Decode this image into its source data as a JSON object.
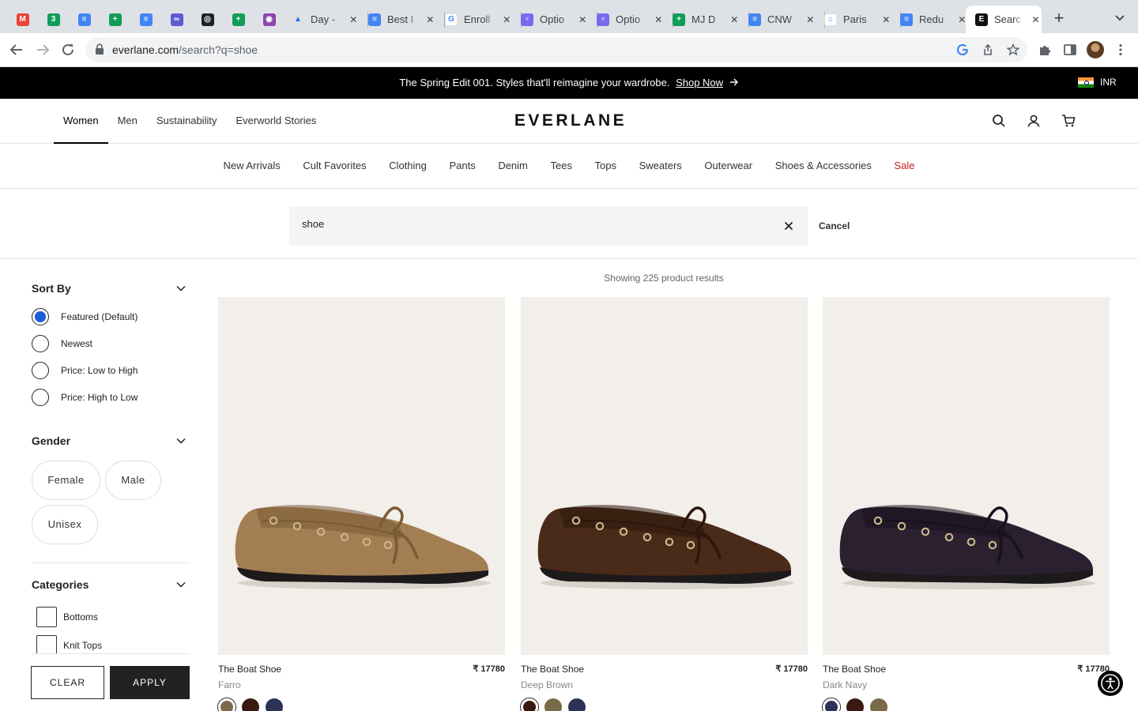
{
  "browser": {
    "tabs": [
      {
        "title": "",
        "color": "#ea4335",
        "glyph": "M",
        "pinned": true
      },
      {
        "title": "",
        "color": "#0f9d58",
        "glyph": "3",
        "pinned": true
      },
      {
        "title": "",
        "color": "#4285f4",
        "glyph": "≡",
        "pinned": true
      },
      {
        "title": "",
        "color": "#0f9d58",
        "glyph": "+",
        "pinned": true
      },
      {
        "title": "",
        "color": "#4285f4",
        "glyph": "≡",
        "pinned": true
      },
      {
        "title": "",
        "color": "#5b5bd6",
        "glyph": "∞",
        "pinned": true
      },
      {
        "title": "",
        "color": "#202124",
        "glyph": "◎",
        "pinned": true
      },
      {
        "title": "",
        "color": "#0f9d58",
        "glyph": "+",
        "pinned": true
      },
      {
        "title": "",
        "color": "#8e44ad",
        "glyph": "◉",
        "pinned": true
      },
      {
        "title": "Day -",
        "color": "#fbbc04",
        "glyph": "▲"
      },
      {
        "title": "Best I",
        "color": "#4285f4",
        "glyph": "≡"
      },
      {
        "title": "Enroll",
        "color": "#ffffff",
        "glyph": "G"
      },
      {
        "title": "Optio",
        "color": "#7b68ee",
        "glyph": "♆"
      },
      {
        "title": "Optio",
        "color": "#7b68ee",
        "glyph": "♆"
      },
      {
        "title": "MJ D",
        "color": "#0f9d58",
        "glyph": "+"
      },
      {
        "title": "CNW",
        "color": "#4285f4",
        "glyph": "≡"
      },
      {
        "title": "Paris",
        "color": "#ffffff",
        "glyph": "⌂"
      },
      {
        "title": "Redu",
        "color": "#4285f4",
        "glyph": "≡"
      },
      {
        "title": "Searc",
        "color": "#111111",
        "glyph": "E",
        "active": true
      }
    ],
    "url_host": "everlane.com",
    "url_path": "/search?q=shoe"
  },
  "promo": {
    "message": "The Spring Edit 001. Styles that'll reimagine your wardrobe.",
    "link": "Shop Now",
    "currency": "INR"
  },
  "header": {
    "primary_nav": [
      "Women",
      "Men",
      "Sustainability",
      "Everworld Stories"
    ],
    "active": "Women",
    "logo": "EVERLANE"
  },
  "category_nav": [
    "New Arrivals",
    "Cult Favorites",
    "Clothing",
    "Pants",
    "Denim",
    "Tees",
    "Tops",
    "Sweaters",
    "Outerwear",
    "Shoes & Accessories",
    "Sale"
  ],
  "search": {
    "query": "shoe",
    "cancel_label": "Cancel"
  },
  "filters": {
    "sort_title": "Sort By",
    "sort_options": [
      "Featured (Default)",
      "Newest",
      "Price: Low to High",
      "Price: High to Low"
    ],
    "sort_selected": 0,
    "gender_title": "Gender",
    "genders": [
      "Female",
      "Male",
      "Unisex"
    ],
    "categories_title": "Categories",
    "categories": [
      "Bottoms",
      "Knit Tops"
    ],
    "clear_label": "CLEAR",
    "apply_label": "APPLY"
  },
  "results": {
    "count_text": "Showing 225 product results",
    "products": [
      {
        "name": "The Boat Shoe",
        "price": "₹ 17780",
        "color_name": "Farro",
        "shoe_color": "#a27e52",
        "shoe_shade": "#7a5a35",
        "swatches": [
          "#7b6a4a",
          "#3a1a10",
          "#2c3356"
        ]
      },
      {
        "name": "The Boat Shoe",
        "price": "₹ 17780",
        "color_name": "Deep Brown",
        "shoe_color": "#4a2a18",
        "shoe_shade": "#2c170c",
        "swatches": [
          "#3a1a10",
          "#7b6a4a",
          "#2c3356"
        ]
      },
      {
        "name": "The Boat Shoe",
        "price": "₹ 17780",
        "color_name": "Dark Navy",
        "shoe_color": "#2a2030",
        "shoe_shade": "#17121c",
        "swatches": [
          "#2c3356",
          "#3a1a10",
          "#7b6a4a"
        ]
      }
    ]
  }
}
